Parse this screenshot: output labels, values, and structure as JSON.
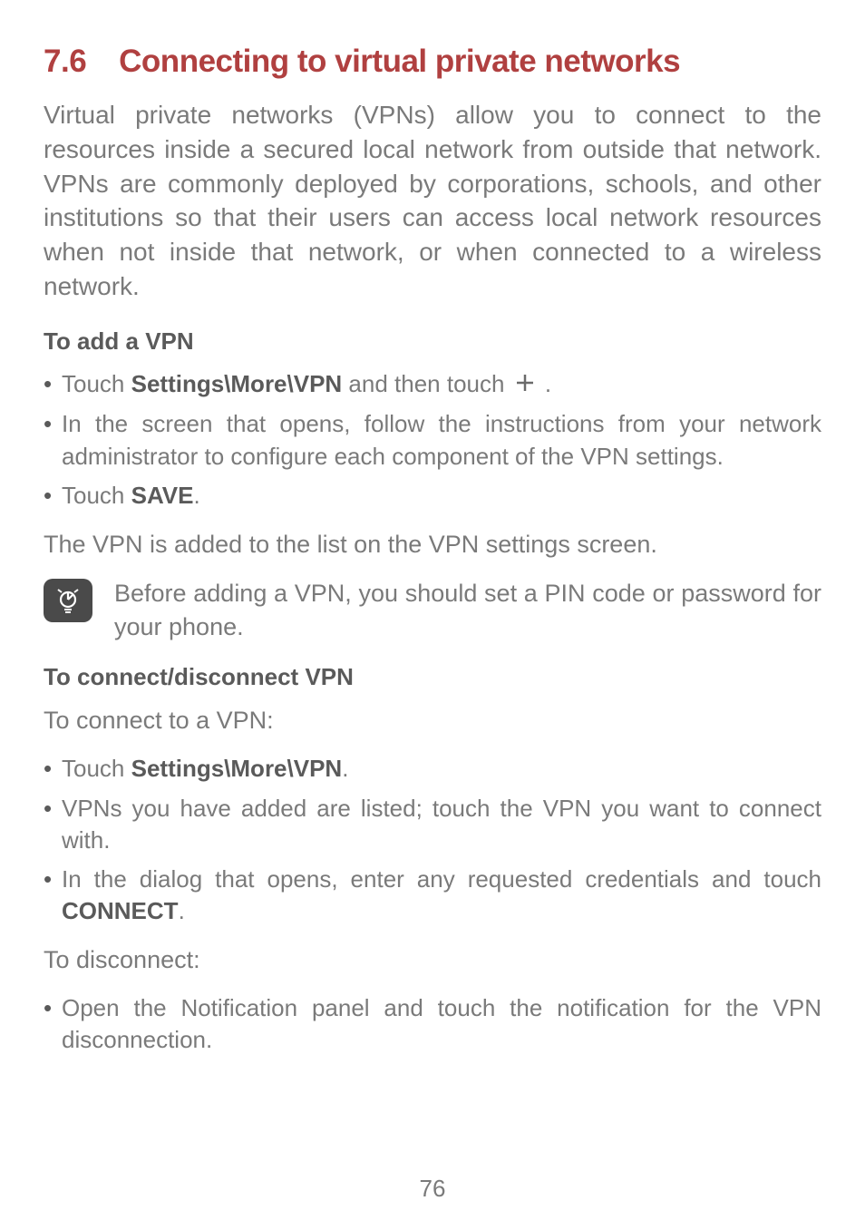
{
  "heading": {
    "number": "7.6",
    "title": "Connecting to virtual private networks"
  },
  "intro": "Virtual private networks (VPNs) allow you to connect to the resources inside a secured local network from outside that network. VPNs are commonly deployed by corporations, schools, and other institutions so that their users can access local network resources when not inside that network, or when connected to a wireless network.",
  "subAddVpn": "To add a VPN",
  "addList": {
    "item1_pre": "Touch ",
    "item1_bold": "Settings\\More\\VPN",
    "item1_mid": " and then touch ",
    "item1_post": " .",
    "item2": "In the screen that opens, follow the instructions from your network administrator to configure each component of the VPN settings.",
    "item3_pre": "Touch ",
    "item3_bold": "SAVE",
    "item3_post": "."
  },
  "afterAdd": "The VPN is added to the list on the VPN settings screen.",
  "noteText": "Before adding a VPN, you should set a PIN code or password for your phone.",
  "subConnect": "To connect/disconnect VPN",
  "connectIntro": "To connect to a VPN:",
  "connectList": {
    "item1_pre": "Touch ",
    "item1_bold": "Settings\\More\\VPN",
    "item1_post": ".",
    "item2": "VPNs you have added are listed; touch the VPN you want to connect with.",
    "item3_pre": "In the dialog that opens, enter any requested credentials and touch ",
    "item3_bold": "CONNECT",
    "item3_post": "."
  },
  "disconnectIntro": "To disconnect:",
  "disconnectList": {
    "item1": "Open the Notification panel and touch the notification for the VPN disconnection."
  },
  "pageNumber": "76"
}
